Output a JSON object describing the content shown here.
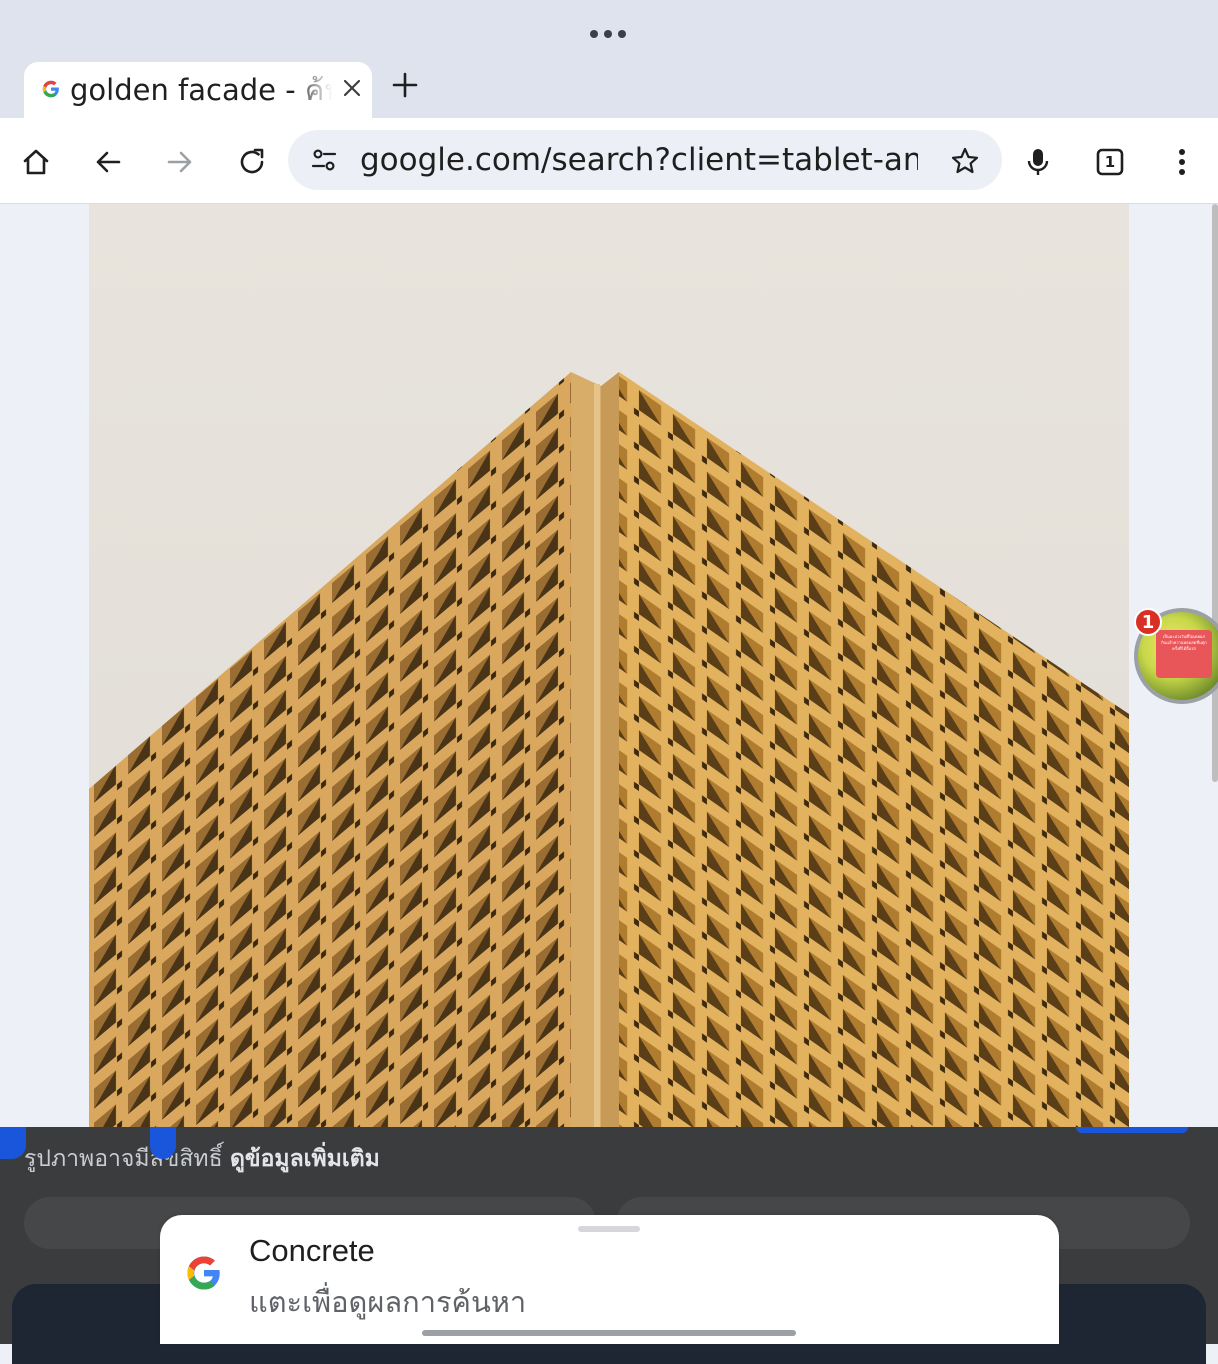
{
  "browser": {
    "tab": {
      "title": "golden facade - ค้นหา",
      "favicon": "google-g-icon"
    },
    "url": "google.com/search?client=tablet-android",
    "tab_count": "1"
  },
  "image_viewer": {
    "credit_text": "รูปภาพอาจมีลิขสิทธิ์",
    "credit_link": "ดูข้อมูลเพิ่มเติม"
  },
  "floating_bubble": {
    "badge_count": "1",
    "sign_text": "เป็นมะม่วงวันที่ไม่เคยแก่ กินแล้วหวานหอมสดชื่นทุกครั้งที่ได้ลิ้มรส"
  },
  "suggestion_sheet": {
    "title": "Concrete",
    "subtitle": "แตะเพื่อดูผลการค้นหา"
  },
  "colors": {
    "tabstrip": "#dfe3ee",
    "accent_blue": "#1a56db",
    "sheet_bg": "#ffffff",
    "dark_panel": "#3b3c3e"
  }
}
